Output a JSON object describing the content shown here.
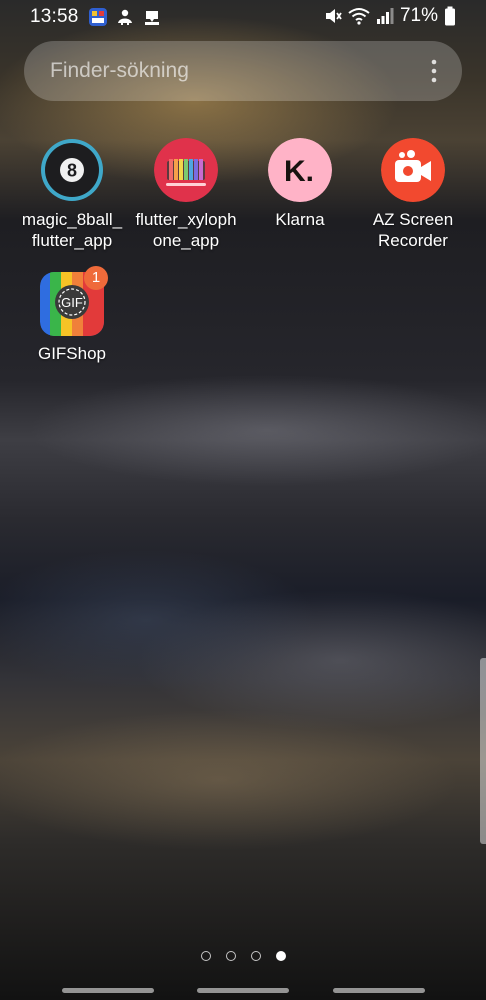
{
  "status_bar": {
    "time": "13:58",
    "notification_icons": [
      "app-notification-icon",
      "usb-debug-icon",
      "download-icon"
    ],
    "right_icons": [
      "mute-icon",
      "wifi-icon",
      "signal-icon",
      "battery-icon"
    ],
    "battery_percent": "71%"
  },
  "search": {
    "placeholder": "Finder-sökning"
  },
  "apps": [
    {
      "label": "magic_8ball_\nflutter_app",
      "icon": "magic-8ball-icon",
      "badge": ""
    },
    {
      "label": "flutter_xyloph\none_app",
      "icon": "xylophone-icon",
      "badge": ""
    },
    {
      "label": "Klarna",
      "icon": "klarna-icon",
      "badge": ""
    },
    {
      "label": "AZ Screen\nRecorder",
      "icon": "screen-recorder-icon",
      "badge": ""
    },
    {
      "label": "GIFShop",
      "icon": "gifshop-icon",
      "badge": "1"
    }
  ],
  "gifshop_icon_text": "GIF",
  "magic8_icon_text": "8",
  "klarna_icon_text": "K.",
  "page_indicator": {
    "total": 4,
    "active": 4
  },
  "colors": {
    "klarna_pink": "#ffb3c7",
    "recorder_red": "#f2492f",
    "xylophone_red": "#e0324b",
    "badge_orange": "#ef6a3a"
  }
}
